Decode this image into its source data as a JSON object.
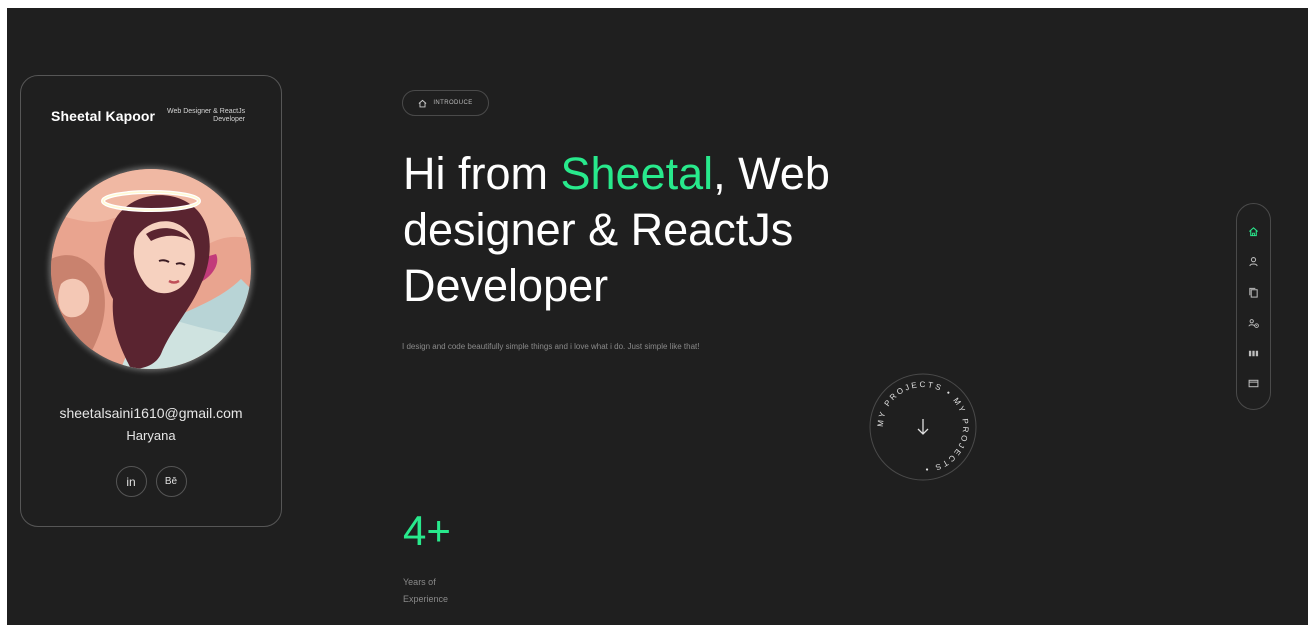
{
  "profile": {
    "name": "Sheetal Kapoor",
    "role": "Web Designer & ReactJs Developer",
    "email": "sheetalsaini1610@gmail.com",
    "location": "Haryana",
    "social": [
      {
        "label": "in",
        "icon": "linkedin-icon"
      },
      {
        "label": "Bē",
        "icon": "behance-icon"
      }
    ]
  },
  "intro": {
    "pill_label": "INTRODUCE",
    "headline_pre": "Hi from ",
    "headline_accent": "Sheetal",
    "headline_post": ", Web designer & ReactJs Developer",
    "tagline": "I design and code beautifully simple things and i love what i do. Just simple like that!"
  },
  "projects_badge": {
    "ring_text": "MY PROJECTS • MY PROJECTS •"
  },
  "stats": {
    "value": "4+",
    "label": "Years of Experience"
  },
  "rail": {
    "items": [
      {
        "icon": "home-icon",
        "active": true
      },
      {
        "icon": "user-icon",
        "active": false
      },
      {
        "icon": "copy-icon",
        "active": false
      },
      {
        "icon": "users-settings-icon",
        "active": false
      },
      {
        "icon": "grid-icon",
        "active": false
      },
      {
        "icon": "mail-icon",
        "active": false
      }
    ]
  },
  "colors": {
    "background": "#1f1f1f",
    "accent": "#28e98c",
    "border": "#565656",
    "text": "#ffffff"
  }
}
